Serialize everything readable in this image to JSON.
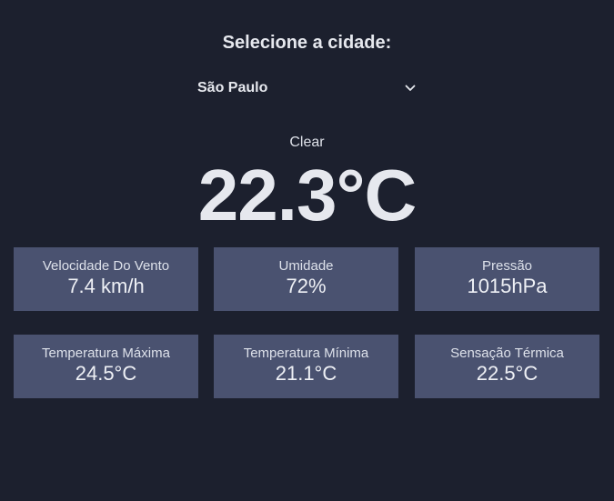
{
  "header": {
    "title": "Selecione a cidade:"
  },
  "city_select": {
    "value": "São Paulo",
    "icon": "chevron-down-icon"
  },
  "weather": {
    "condition": "Clear",
    "temperature": "22.3°C"
  },
  "cards": [
    {
      "label": "Velocidade Do Vento",
      "value": "7.4 km/h"
    },
    {
      "label": "Umidade",
      "value": "72%"
    },
    {
      "label": "Pressão",
      "value": "1015hPa"
    },
    {
      "label": "Temperatura Máxima",
      "value": "24.5°C"
    },
    {
      "label": "Temperatura Mínima",
      "value": "21.1°C"
    },
    {
      "label": "Sensação Térmica",
      "value": "22.5°C"
    }
  ],
  "colors": {
    "background": "#1c202e",
    "card": "#4a5270",
    "text": "#e6e8ee"
  }
}
